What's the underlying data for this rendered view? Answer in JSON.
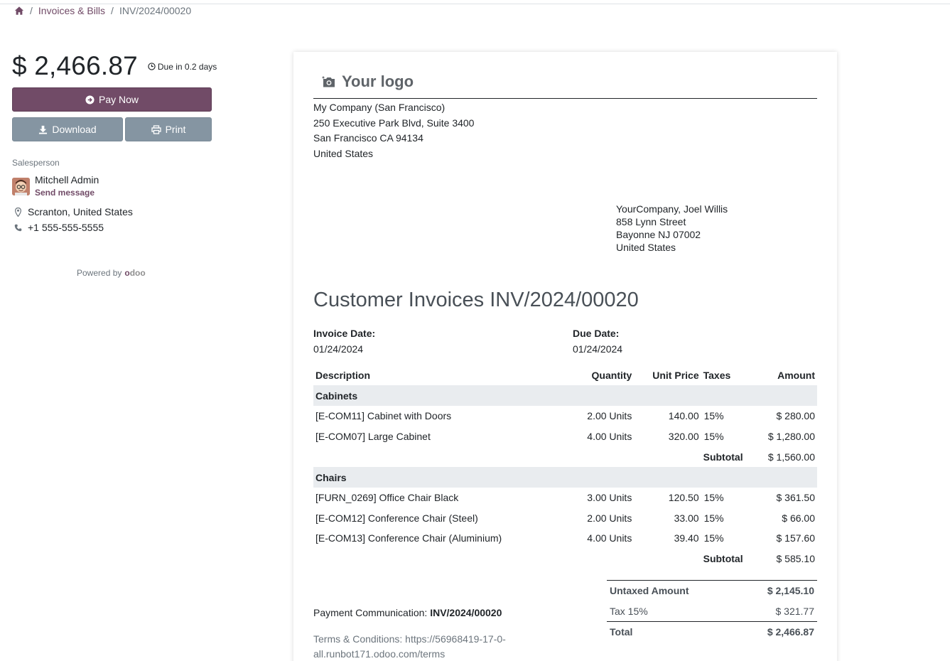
{
  "breadcrumb": {
    "home_icon": "home-icon",
    "items": [
      "Invoices & Bills",
      "INV/2024/00020"
    ]
  },
  "summary": {
    "amount": "$ 2,466.87",
    "due": "Due in 0.2 days"
  },
  "actions": {
    "pay_now": "Pay Now",
    "download": "Download",
    "print": "Print"
  },
  "salesperson": {
    "label": "Salesperson",
    "name": "Mitchell Admin",
    "send_message": "Send message",
    "location": "Scranton, United States",
    "phone": "+1 555-555-5555"
  },
  "powered": {
    "text": "Powered by",
    "brand_o": "o",
    "brand_rest": "doo"
  },
  "invoice": {
    "logo_text": "Your logo",
    "company_lines": [
      "My Company (San Francisco)",
      "250 Executive Park Blvd, Suite 3400",
      "San Francisco CA 94134",
      "United States"
    ],
    "customer_lines": [
      "YourCompany, Joel Willis",
      "858 Lynn Street",
      "Bayonne NJ 07002",
      "United States"
    ],
    "title": "Customer Invoices INV/2024/00020",
    "invoice_date_label": "Invoice Date:",
    "invoice_date": "01/24/2024",
    "due_date_label": "Due Date:",
    "due_date": "01/24/2024",
    "columns": {
      "description": "Description",
      "quantity": "Quantity",
      "unit_price": "Unit Price",
      "taxes": "Taxes",
      "amount": "Amount"
    },
    "sections": [
      {
        "name": "Cabinets",
        "lines": [
          {
            "description": "[E-COM11] Cabinet with Doors",
            "quantity": "2.00 Units",
            "unit_price": "140.00",
            "taxes": "15%",
            "amount": "$ 280.00"
          },
          {
            "description": "[E-COM07] Large Cabinet",
            "quantity": "4.00 Units",
            "unit_price": "320.00",
            "taxes": "15%",
            "amount": "$ 1,280.00"
          }
        ],
        "subtotal_label": "Subtotal",
        "subtotal": "$ 1,560.00"
      },
      {
        "name": "Chairs",
        "lines": [
          {
            "description": "[FURN_0269] Office Chair Black",
            "quantity": "3.00 Units",
            "unit_price": "120.50",
            "taxes": "15%",
            "amount": "$ 361.50"
          },
          {
            "description": "[E-COM12] Conference Chair (Steel)",
            "quantity": "2.00 Units",
            "unit_price": "33.00",
            "taxes": "15%",
            "amount": "$ 66.00"
          },
          {
            "description": "[E-COM13] Conference Chair (Aluminium)",
            "quantity": "4.00 Units",
            "unit_price": "39.40",
            "taxes": "15%",
            "amount": "$ 157.60"
          }
        ],
        "subtotal_label": "Subtotal",
        "subtotal": "$ 585.10"
      }
    ],
    "totals": {
      "untaxed_label": "Untaxed Amount",
      "untaxed": "$ 2,145.10",
      "tax_label": "Tax 15%",
      "tax": "$ 321.77",
      "total_label": "Total",
      "total": "$ 2,466.87"
    },
    "payment_comm_label": "Payment Communication:",
    "payment_comm": "INV/2024/00020",
    "terms": "Terms & Conditions: https://56968419-17-0-all.runbot171.odoo.com/terms"
  }
}
